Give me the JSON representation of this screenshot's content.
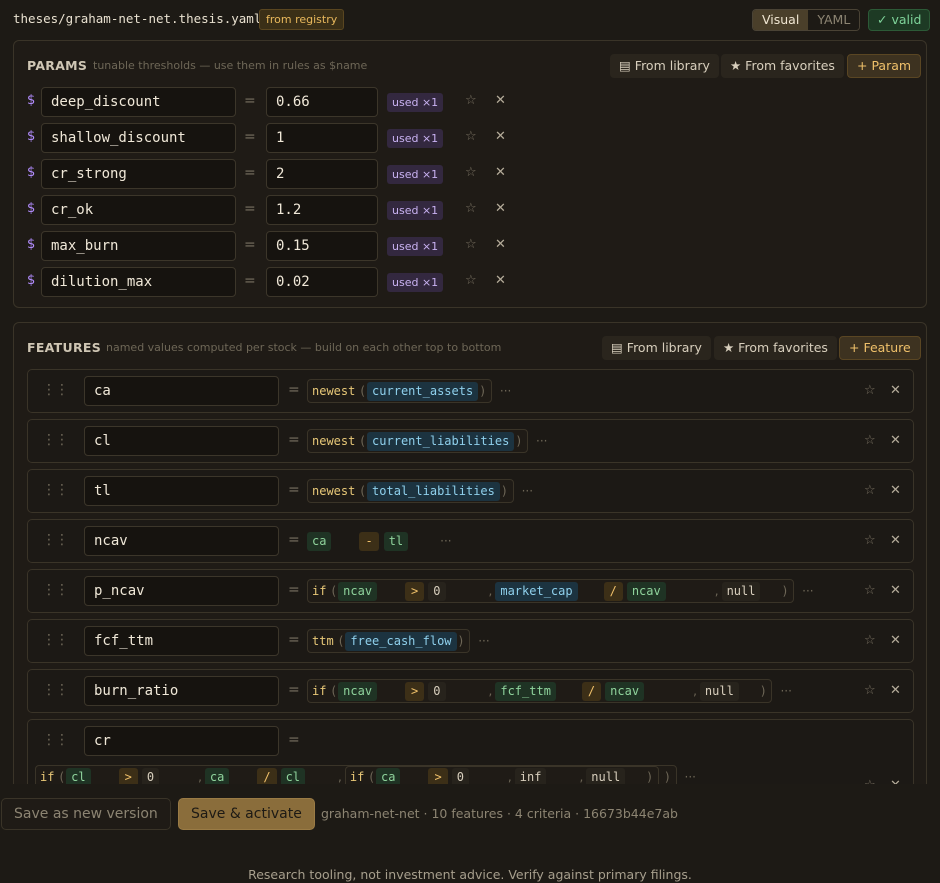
{
  "topbar": {
    "file_path": "theses/graham-net-net.thesis.yaml",
    "registry_badge": "from registry",
    "view_visual": "Visual",
    "view_yaml": "YAML",
    "valid": "✓ valid"
  },
  "params": {
    "title": "PARAMS",
    "subtitle": "tunable thresholds — use them in rules as $name",
    "from_library": "▤ From library",
    "from_favorites": "★ From favorites",
    "add": "+ Param",
    "dollar": "$",
    "eq": "=",
    "items": [
      {
        "name": "deep_discount",
        "value": "0.66",
        "used": "used ×1"
      },
      {
        "name": "shallow_discount",
        "value": "1",
        "used": "used ×1"
      },
      {
        "name": "cr_strong",
        "value": "2",
        "used": "used ×1"
      },
      {
        "name": "cr_ok",
        "value": "1.2",
        "used": "used ×1"
      },
      {
        "name": "max_burn",
        "value": "0.15",
        "used": "used ×1"
      },
      {
        "name": "dilution_max",
        "value": "0.02",
        "used": "used ×1"
      }
    ]
  },
  "features": {
    "title": "FEATURES",
    "subtitle": "named values computed per stock — build on each other top to bottom",
    "from_library": "▤ From library",
    "from_favorites": "★ From favorites",
    "add": "+ Feature",
    "eq": "=",
    "items": [
      {
        "name": "ca"
      },
      {
        "name": "cl"
      },
      {
        "name": "tl"
      },
      {
        "name": "ncav"
      },
      {
        "name": "p_ncav"
      },
      {
        "name": "fcf_ttm"
      },
      {
        "name": "burn_ratio"
      },
      {
        "name": "cr"
      }
    ],
    "exprs": {
      "ca": {
        "fn": "newest",
        "arg": "current_assets"
      },
      "cl": {
        "fn": "newest",
        "arg": "current_liabilities"
      },
      "tl": {
        "fn": "newest",
        "arg": "total_liabilities"
      },
      "ncav": {
        "left": "ca",
        "op": "-",
        "right": "tl"
      },
      "p_ncav": {
        "fn": "if",
        "a": "ncav",
        "op": ">",
        "b": "0",
        "c": "market_cap",
        "op2": "/",
        "d": "ncav",
        "e": "null"
      },
      "fcf_ttm": {
        "fn": "ttm",
        "arg": "free_cash_flow"
      },
      "burn_ratio": {
        "fn": "if",
        "a": "ncav",
        "op": ">",
        "b": "0",
        "c": "fcf_ttm",
        "op2": "/",
        "d": "ncav",
        "e": "null"
      },
      "cr": {
        "fn": "if",
        "a": "cl",
        "op": ">",
        "b": "0",
        "c": "ca",
        "op2": "/",
        "d": "cl",
        "fn2": "if",
        "f": "ca",
        "op3": ">",
        "g": "0",
        "h": "inf",
        "i": "null"
      }
    }
  },
  "symbols": {
    "open": "(",
    "close": ")",
    "comma": ",",
    "more": "···",
    "star": "☆",
    "close_x": "✕",
    "grip": "⋮⋮"
  },
  "footer": {
    "save_new": "Save as new version",
    "save_activate": "Save & activate",
    "info": "graham-net-net · 10 features · 4 criteria · 16673b44e7ab",
    "disclaimer": "Research tooling, not investment advice. Verify against primary filings."
  }
}
